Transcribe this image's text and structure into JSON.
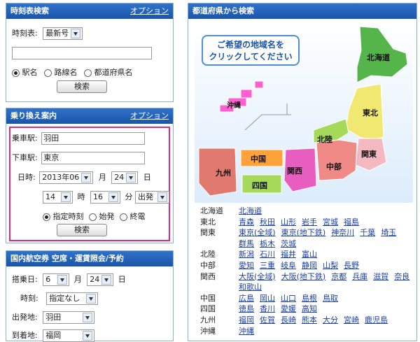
{
  "timetable": {
    "title": "時刻表検索",
    "option": "オプション",
    "edition_label": "時刻表:",
    "edition_value": "最新号",
    "search_value": "",
    "radios": [
      {
        "label": "駅名",
        "checked": true
      },
      {
        "label": "路線名",
        "checked": false
      },
      {
        "label": "都道府県名",
        "checked": false
      }
    ],
    "search_button": "検索"
  },
  "transfer": {
    "title": "乗り換え案内",
    "option": "オプション",
    "from_label": "乗車駅:",
    "from_value": "羽田",
    "to_label": "下車駅:",
    "to_value": "東京",
    "date_label": "日時:",
    "year_month": "2013年06",
    "month_unit": "月",
    "day": "24",
    "day_unit": "日",
    "hour": "14",
    "hour_unit": "時",
    "minute": "16",
    "minute_unit": "分",
    "mode": "出発",
    "radios": [
      {
        "label": "指定時刻",
        "checked": true
      },
      {
        "label": "始発",
        "checked": false
      },
      {
        "label": "終電",
        "checked": false
      }
    ],
    "search_button": "検索"
  },
  "flight": {
    "title": "国内航空券 空席・運賃照会/予約",
    "board_label": "搭乗日:",
    "board_month": "6",
    "month_unit": "月",
    "board_day": "24",
    "day_unit": "日",
    "time_label": "時刻:",
    "time_value": "指定なし",
    "depart_label": "出発地:",
    "depart_value": "羽田",
    "arrive_label": "到着地:",
    "arrive_value": "福岡"
  },
  "map": {
    "title": "都道府県から検索",
    "callout_line1": "ご希望の地域名を",
    "callout_line2": "クリックしてください",
    "regions": {
      "hokkaido": "北海道",
      "tohoku": "東北",
      "kanto": "関東",
      "chubu": "中部",
      "hokuriku": "北陸",
      "kansai": "関西",
      "chugoku": "中国",
      "shikoku": "四国",
      "kyushu": "九州",
      "okinawa": "沖縄"
    },
    "colors": {
      "hokkaido": "#55b44a",
      "tohoku": "#f0e870",
      "kanto": "#f4b8c0",
      "chubu": "#ef8a86",
      "hokuriku": "#a6d95a",
      "kansai": "#e85ec0",
      "chugoku": "#ffa23a",
      "shikoku": "#a6d95a",
      "kyushu": "#e07a6e",
      "okinawa": "#ff5fd0"
    }
  },
  "pref_list": [
    {
      "region": "北海道",
      "prefs": [
        "北海道"
      ]
    },
    {
      "region": "東北",
      "prefs": [
        "青森",
        "秋田",
        "山形",
        "岩手",
        "宮城",
        "福島"
      ]
    },
    {
      "region": "関東",
      "prefs": [
        "東京(全域)",
        "東京(地下鉄)",
        "神奈川",
        "千葉",
        "埼玉"
      ]
    },
    {
      "region": "",
      "prefs": [
        "群馬",
        "栃木",
        "茨城"
      ]
    },
    {
      "region": "北陸",
      "prefs": [
        "新潟",
        "石川",
        "福井",
        "富山"
      ]
    },
    {
      "region": "中部",
      "prefs": [
        "愛知",
        "三重",
        "岐阜",
        "静岡",
        "山梨",
        "長野"
      ]
    },
    {
      "region": "関西",
      "prefs": [
        "大阪(全域)",
        "大阪(地下鉄)",
        "京都",
        "兵庫",
        "滋賀",
        "奈良"
      ]
    },
    {
      "region": "",
      "prefs": [
        "和歌山"
      ]
    },
    {
      "region": "中国",
      "prefs": [
        "広島",
        "岡山",
        "山口",
        "島根",
        "鳥取"
      ]
    },
    {
      "region": "四国",
      "prefs": [
        "徳島",
        "香川",
        "愛媛",
        "高知"
      ]
    },
    {
      "region": "九州",
      "prefs": [
        "福岡",
        "佐賀",
        "長崎",
        "熊本",
        "大分",
        "宮崎",
        "鹿児島"
      ]
    },
    {
      "region": "沖縄",
      "prefs": [
        "沖縄"
      ]
    }
  ]
}
